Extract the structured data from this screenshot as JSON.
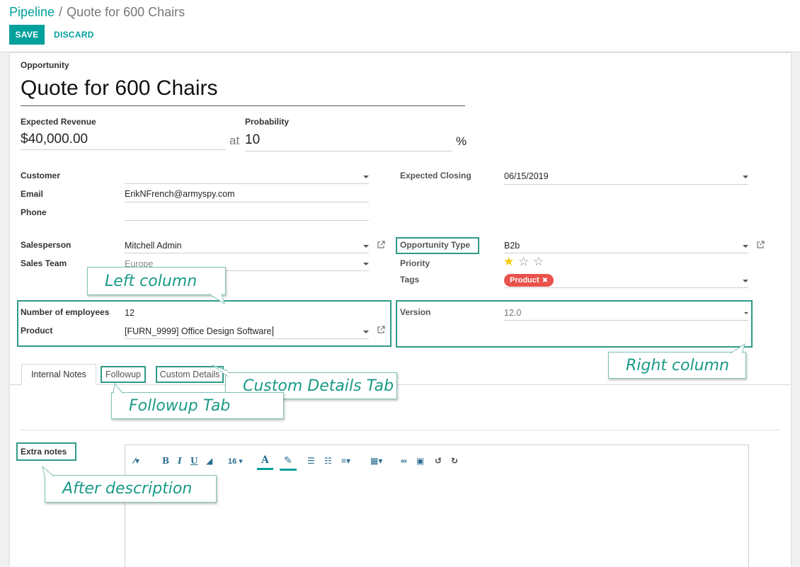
{
  "breadcrumb": {
    "parent": "Pipeline",
    "separator": "/",
    "current": "Quote for 600 Chairs"
  },
  "toolbar": {
    "save_label": "SAVE",
    "discard_label": "DISCARD"
  },
  "form": {
    "opportunity_label": "Opportunity",
    "name": "Quote for 600 Chairs",
    "expected_revenue_label": "Expected Revenue",
    "expected_revenue": "$40,000.00",
    "at_label": "at",
    "probability_label": "Probability",
    "probability": "10",
    "percent": "%",
    "left": {
      "customer_label": "Customer",
      "customer": "",
      "email_label": "Email",
      "email": "ErikNFrench@armyspy.com",
      "phone_label": "Phone",
      "phone": "",
      "salesperson_label": "Salesperson",
      "salesperson": "Mitchell Admin",
      "sales_team_label": "Sales Team",
      "sales_team": "Europe",
      "employees_label": "Number of employees",
      "employees": "12",
      "product_label": "Product",
      "product": "[FURN_9999] Office Design Software"
    },
    "right": {
      "expected_closing_label": "Expected Closing",
      "expected_closing": "06/15/2019",
      "opportunity_type_label": "Opportunity Type",
      "opportunity_type": "B2b",
      "priority_label": "Priority",
      "priority_stars": 1,
      "priority_max": 3,
      "tags_label": "Tags",
      "tag": "Product",
      "version_label": "Version",
      "version": "12.0"
    }
  },
  "tabs": [
    {
      "label": "Internal Notes",
      "active": true
    },
    {
      "label": "Followup",
      "active": false
    },
    {
      "label": "Custom Details",
      "active": false
    }
  ],
  "extra_notes_label": "Extra notes",
  "editor": {
    "font_size": "16"
  },
  "callouts": {
    "left_column": "Left column",
    "right_column": "Right column",
    "custom_details_tab": "Custom Details Tab",
    "followup_tab": "Followup Tab",
    "after_description": "After description"
  },
  "colors": {
    "accent": "#00a09d",
    "highlight": "#2f9a86",
    "tag": "#e8524a",
    "star": "#f3cc00"
  }
}
